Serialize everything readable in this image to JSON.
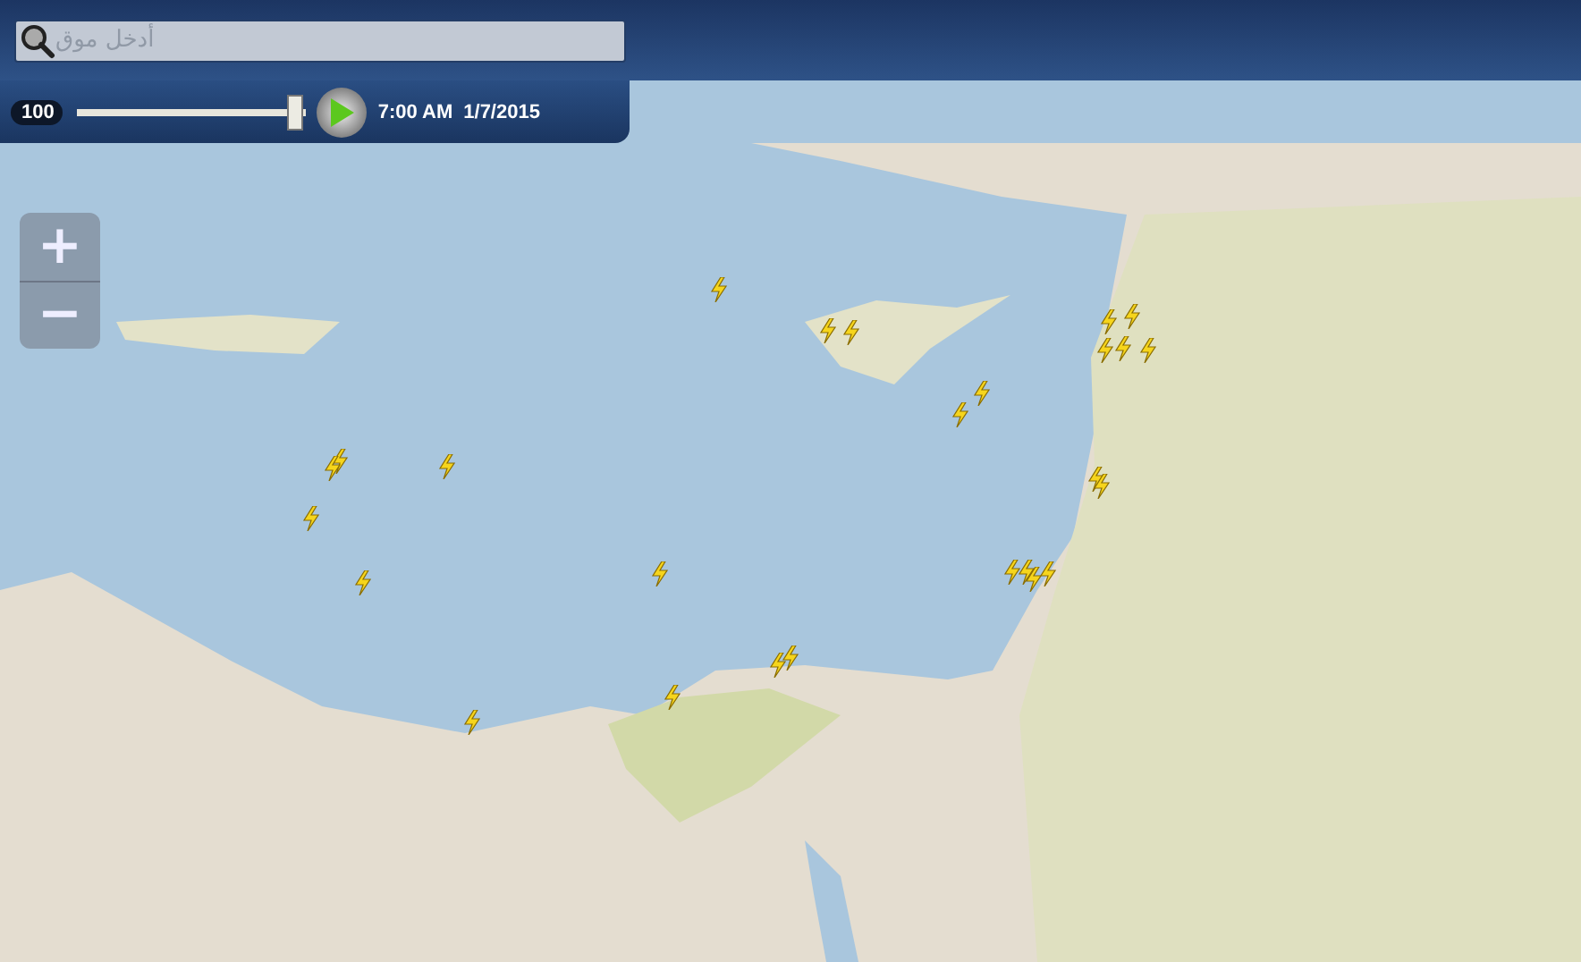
{
  "search": {
    "placeholder": "أدخل موق"
  },
  "timeline": {
    "speed": "100",
    "level": 0.95,
    "time": "7:00 AM",
    "date": "1/7/2015"
  },
  "zoom": {
    "zoom_in": "+",
    "zoom_out": "−"
  }
}
